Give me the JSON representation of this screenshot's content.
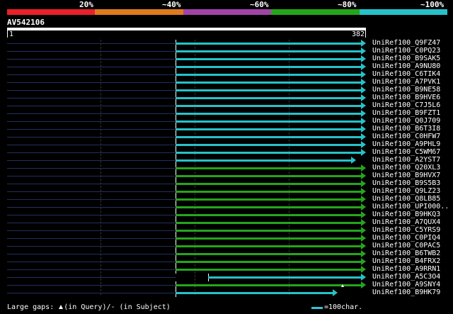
{
  "legend": {
    "labels": [
      "20%",
      "~40%",
      "~60%",
      "~80%",
      "~100%"
    ],
    "colors": [
      "#e8202a",
      "#e07a1f",
      "#a044a8",
      "#25a51b",
      "#26c2c9"
    ]
  },
  "query": {
    "id": "AV542106",
    "start": "1",
    "end": "382"
  },
  "hits": [
    {
      "name": "UniRef100_Q9FZ47",
      "from": 1,
      "to": 382,
      "color": "cyan",
      "mark": "line"
    },
    {
      "name": "UniRef100_C0PQ23",
      "from": 1,
      "to": 382,
      "color": "cyan",
      "mark": "line"
    },
    {
      "name": "UniRef100_B9SAK5",
      "from": 1,
      "to": 382,
      "color": "cyan",
      "mark": "line"
    },
    {
      "name": "UniRef100_A9NU80",
      "from": 1,
      "to": 382,
      "color": "cyan",
      "mark": "line"
    },
    {
      "name": "UniRef100_C6TIK4",
      "from": 1,
      "to": 382,
      "color": "cyan",
      "mark": "line"
    },
    {
      "name": "UniRef100_A7PVK1",
      "from": 1,
      "to": 382,
      "color": "cyan",
      "mark": "line"
    },
    {
      "name": "UniRef100_B9NE58",
      "from": 1,
      "to": 382,
      "color": "cyan",
      "mark": "line"
    },
    {
      "name": "UniRef100_B9HVE6",
      "from": 1,
      "to": 382,
      "color": "cyan",
      "mark": "line"
    },
    {
      "name": "UniRef100_C7J5L6",
      "from": 1,
      "to": 382,
      "color": "cyan",
      "mark": "line"
    },
    {
      "name": "UniRef100_B9FZT1",
      "from": 1,
      "to": 382,
      "color": "cyan",
      "mark": "line"
    },
    {
      "name": "UniRef100_Q0J709",
      "from": 1,
      "to": 382,
      "color": "cyan",
      "mark": "line"
    },
    {
      "name": "UniRef100_B6T3I8",
      "from": 1,
      "to": 382,
      "color": "cyan",
      "mark": "line"
    },
    {
      "name": "UniRef100_C0HFW7",
      "from": 1,
      "to": 382,
      "color": "cyan",
      "mark": "line"
    },
    {
      "name": "UniRef100_A9PHL9",
      "from": 1,
      "to": 382,
      "color": "cyan",
      "mark": "line"
    },
    {
      "name": "UniRef100_C5WM67",
      "from": 1,
      "to": 382,
      "color": "cyan",
      "mark": "line"
    },
    {
      "name": "UniRef100_A2YST7",
      "from": 1,
      "to": 362,
      "color": "cyan",
      "mark": "line"
    },
    {
      "name": "UniRef100_Q20XL3",
      "from": 1,
      "to": 382,
      "color": "green",
      "mark": "line"
    },
    {
      "name": "UniRef100_B9HVX7",
      "from": 1,
      "to": 382,
      "color": "green",
      "mark": "line"
    },
    {
      "name": "UniRef100_B9S5B3",
      "from": 1,
      "to": 382,
      "color": "green",
      "mark": "line"
    },
    {
      "name": "UniRef100_Q9LZ23",
      "from": 1,
      "to": 382,
      "color": "green",
      "mark": "line"
    },
    {
      "name": "UniRef100_Q8LB85",
      "from": 1,
      "to": 382,
      "color": "green",
      "mark": "line"
    },
    {
      "name": "UniRef100_UPI000..",
      "from": 1,
      "to": 382,
      "color": "green",
      "mark": "line"
    },
    {
      "name": "UniRef100_B9HKQ3",
      "from": 1,
      "to": 382,
      "color": "green",
      "mark": "line"
    },
    {
      "name": "UniRef100_A7QUX4",
      "from": 1,
      "to": 382,
      "color": "green",
      "mark": "line"
    },
    {
      "name": "UniRef100_C5YRS9",
      "from": 1,
      "to": 382,
      "color": "green",
      "mark": "line"
    },
    {
      "name": "UniRef100_C0PIQ4",
      "from": 1,
      "to": 382,
      "color": "green",
      "mark": "line"
    },
    {
      "name": "UniRef100_C0PAC5",
      "from": 1,
      "to": 382,
      "color": "green",
      "mark": "line"
    },
    {
      "name": "UniRef100_B6TWB2",
      "from": 1,
      "to": 382,
      "color": "green",
      "mark": "line"
    },
    {
      "name": "UniRef100_B4FRX2",
      "from": 1,
      "to": 382,
      "color": "green",
      "mark": "line"
    },
    {
      "name": "UniRef100_A9RRN1",
      "from": 1,
      "to": 382,
      "color": "green",
      "mark": "line"
    },
    {
      "name": "UniRef100_A5C3O4",
      "from": 68,
      "to": 382,
      "color": "cyan",
      "mark": "sep"
    },
    {
      "name": "UniRef100_A9SNY4",
      "from": 1,
      "to": 382,
      "color": "green",
      "mark": "gap"
    },
    {
      "name": "UniRef100_B9HK79",
      "from": 1,
      "to": 324,
      "color": "cyan",
      "mark": "line"
    }
  ],
  "footer": {
    "gaps_prefix": "Large gaps:",
    "gaps_query": "(in Query)/",
    "gaps_subject": "- (in Subject)",
    "scale_label": "=100char."
  }
}
